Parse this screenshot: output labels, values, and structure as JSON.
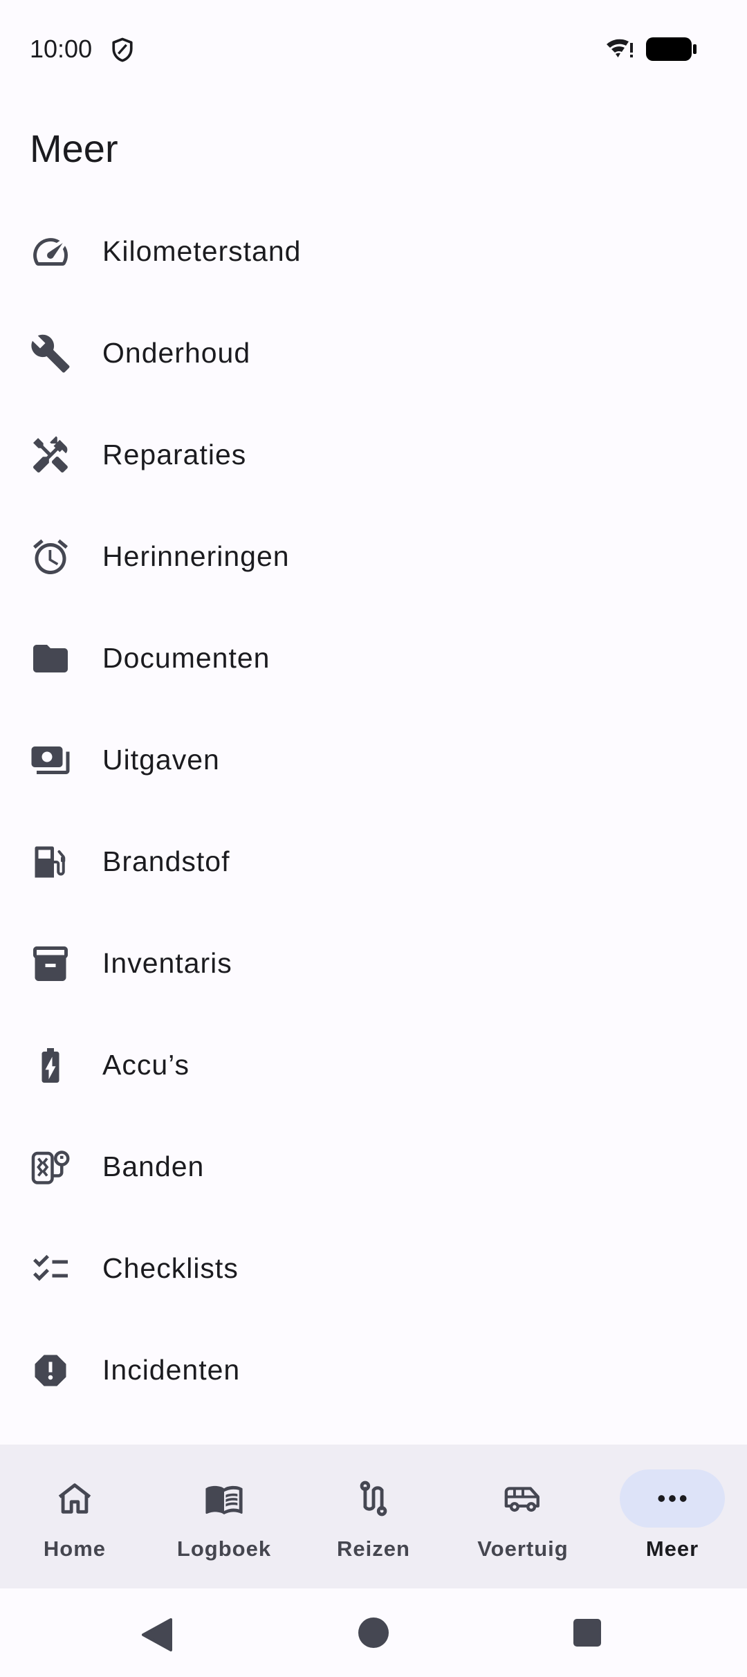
{
  "status_bar": {
    "time": "10:00",
    "icons": [
      "shield-icon",
      "wifi-icon",
      "battery-icon"
    ]
  },
  "page": {
    "title": "Meer"
  },
  "menu": {
    "items": [
      {
        "label": "Kilometerstand",
        "icon": "speedometer-icon"
      },
      {
        "label": "Onderhoud",
        "icon": "wrench-icon"
      },
      {
        "label": "Reparaties",
        "icon": "tools-icon"
      },
      {
        "label": "Herinneringen",
        "icon": "alarm-icon"
      },
      {
        "label": "Documenten",
        "icon": "folder-icon"
      },
      {
        "label": "Uitgaven",
        "icon": "payments-icon"
      },
      {
        "label": "Brandstof",
        "icon": "fuel-icon"
      },
      {
        "label": "Inventaris",
        "icon": "archive-icon"
      },
      {
        "label": "Accu’s",
        "icon": "battery-charging-icon"
      },
      {
        "label": "Banden",
        "icon": "tire-icon"
      },
      {
        "label": "Checklists",
        "icon": "checklist-icon"
      },
      {
        "label": "Incidenten",
        "icon": "report-icon"
      }
    ]
  },
  "bottom_nav": {
    "items": [
      {
        "label": "Home",
        "icon": "home-icon",
        "active": false
      },
      {
        "label": "Logboek",
        "icon": "book-icon",
        "active": false
      },
      {
        "label": "Reizen",
        "icon": "route-icon",
        "active": false
      },
      {
        "label": "Voertuig",
        "icon": "van-icon",
        "active": false
      },
      {
        "label": "Meer",
        "icon": "more-icon",
        "active": true
      }
    ]
  },
  "colors": {
    "background": "#fdfbff",
    "nav_background": "#efedf4",
    "active_indicator": "#dde3f8",
    "icon": "#454752",
    "text": "#1b1b1f"
  }
}
